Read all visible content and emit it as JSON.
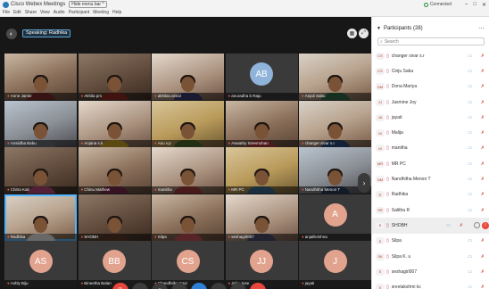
{
  "window": {
    "title": "Cisco Webex Meetings",
    "menu_hint": "Hide menu bar ^",
    "connection": "Connected",
    "controls": [
      "–",
      "□",
      "✕"
    ]
  },
  "menu": [
    "File",
    "Edit",
    "Share",
    "View",
    "Audio",
    "Participant",
    "Meeting",
    "Help"
  ],
  "meeting": {
    "speaking": "Speaking: Radhika",
    "tiles": [
      {
        "name": "Anne Jamie",
        "type": "photo",
        "style": "c0",
        "shirt": "#7c2a2a"
      },
      {
        "name": "Akhila pm",
        "type": "photo",
        "style": "c2",
        "shirt": "#8e2a1f"
      },
      {
        "name": "akhilas.nimal",
        "type": "photo",
        "style": "c1",
        "shirt": "#3b3b6b"
      },
      {
        "name": "anuradha b Raju",
        "type": "initial",
        "initials": "AB",
        "color": "#8fb3d9"
      },
      {
        "name": "Anjali Sabu",
        "type": "photo",
        "style": "c5",
        "shirt": "#2f6a4a"
      },
      {
        "name": "Ansiidha Babu",
        "type": "photo",
        "style": "c4",
        "shirt": "#6b6f77"
      },
      {
        "name": "Anjana s.k",
        "type": "photo",
        "style": "c1",
        "shirt": "#c9a227"
      },
      {
        "name": "Anu v.p",
        "type": "photo",
        "style": "c3",
        "shirt": "#4a6a2a"
      },
      {
        "name": "Aswathy Sreemohan",
        "type": "photo",
        "style": "c0",
        "shirt": "#a83a3a"
      },
      {
        "name": "changer sivar s.r",
        "type": "photo",
        "style": "c5",
        "shirt": "#2a4a7a"
      },
      {
        "name": "Chitra Kali",
        "type": "photo",
        "style": "c2",
        "shirt": "#b5467a"
      },
      {
        "name": "Chinu Mathew",
        "type": "photo",
        "style": "c0",
        "shirt": "#7a2a4a"
      },
      {
        "name": "manitha",
        "type": "photo",
        "style": "c1",
        "shirt": "#a03a3a"
      },
      {
        "name": "MR PC",
        "type": "photo",
        "style": "c3",
        "shirt": "#3a6a8a"
      },
      {
        "name": "Nandhitha Menon T",
        "type": "photo",
        "style": "c4",
        "shirt": "#2a3a5a"
      },
      {
        "name": "Radhika",
        "type": "photo",
        "style": "c5",
        "shirt": "#e6e6e6",
        "active": true
      },
      {
        "name": "SHOBH",
        "type": "photo",
        "style": "c2",
        "shirt": "#5a3a2a"
      },
      {
        "name": "Silpa",
        "type": "photo",
        "style": "c0",
        "shirt": "#c0505a"
      },
      {
        "name": "seshagirl007",
        "type": "photo",
        "style": "c1",
        "shirt": "#4a4a6a"
      },
      {
        "name": "anjalikrishna",
        "type": "initial",
        "initials": "A",
        "color": "#e2a38e"
      },
      {
        "name": "Ashly Biju",
        "type": "initial",
        "initials": "AS",
        "color": "#e2a38e"
      },
      {
        "name": "Bineetha Balan",
        "type": "initial",
        "initials": "BB",
        "color": "#e2a38e"
      },
      {
        "name": "Chandhrika Sasi",
        "type": "initial",
        "initials": "CS",
        "color": "#e2a38e"
      },
      {
        "name": "Jaiju Jose",
        "type": "initial",
        "initials": "JJ",
        "color": "#e2a38e"
      },
      {
        "name": "jayati",
        "type": "initial",
        "initials": "J",
        "color": "#e2a38e"
      }
    ],
    "control_icons": [
      "mic-muted-icon",
      "video-icon",
      "share-icon",
      "record-icon",
      "participants-icon",
      "chat-icon",
      "more-icon",
      "end-call-icon"
    ]
  },
  "panel": {
    "title": "Participants (28)",
    "search_placeholder": "Search",
    "participants": [
      {
        "initials": "CS",
        "name": "changer sivar s.r"
      },
      {
        "initials": "CS",
        "name": "Cinju Sabu"
      },
      {
        "initials": "DM",
        "name": "Dona Mariya"
      },
      {
        "initials": "JJ",
        "name": "Jasmine Joy"
      },
      {
        "initials": "JA",
        "name": "jayati"
      },
      {
        "initials": "M",
        "name": "Malija"
      },
      {
        "initials": "M",
        "name": "manitha"
      },
      {
        "initials": "MR",
        "name": "MR PC"
      },
      {
        "initials": "NM",
        "name": "Nandhitha Menon T"
      },
      {
        "initials": "R",
        "name": "Radhika"
      },
      {
        "initials": "SR",
        "name": "Salitha R"
      },
      {
        "initials": "S",
        "name": "SHOBH",
        "highlight": true
      },
      {
        "initials": "S",
        "name": "Silpa"
      },
      {
        "initials": "SK",
        "name": "Silpa K. u"
      },
      {
        "initials": "S",
        "name": "seshagirl007"
      },
      {
        "initials": "S",
        "name": "sreelakshmi kc"
      }
    ]
  }
}
